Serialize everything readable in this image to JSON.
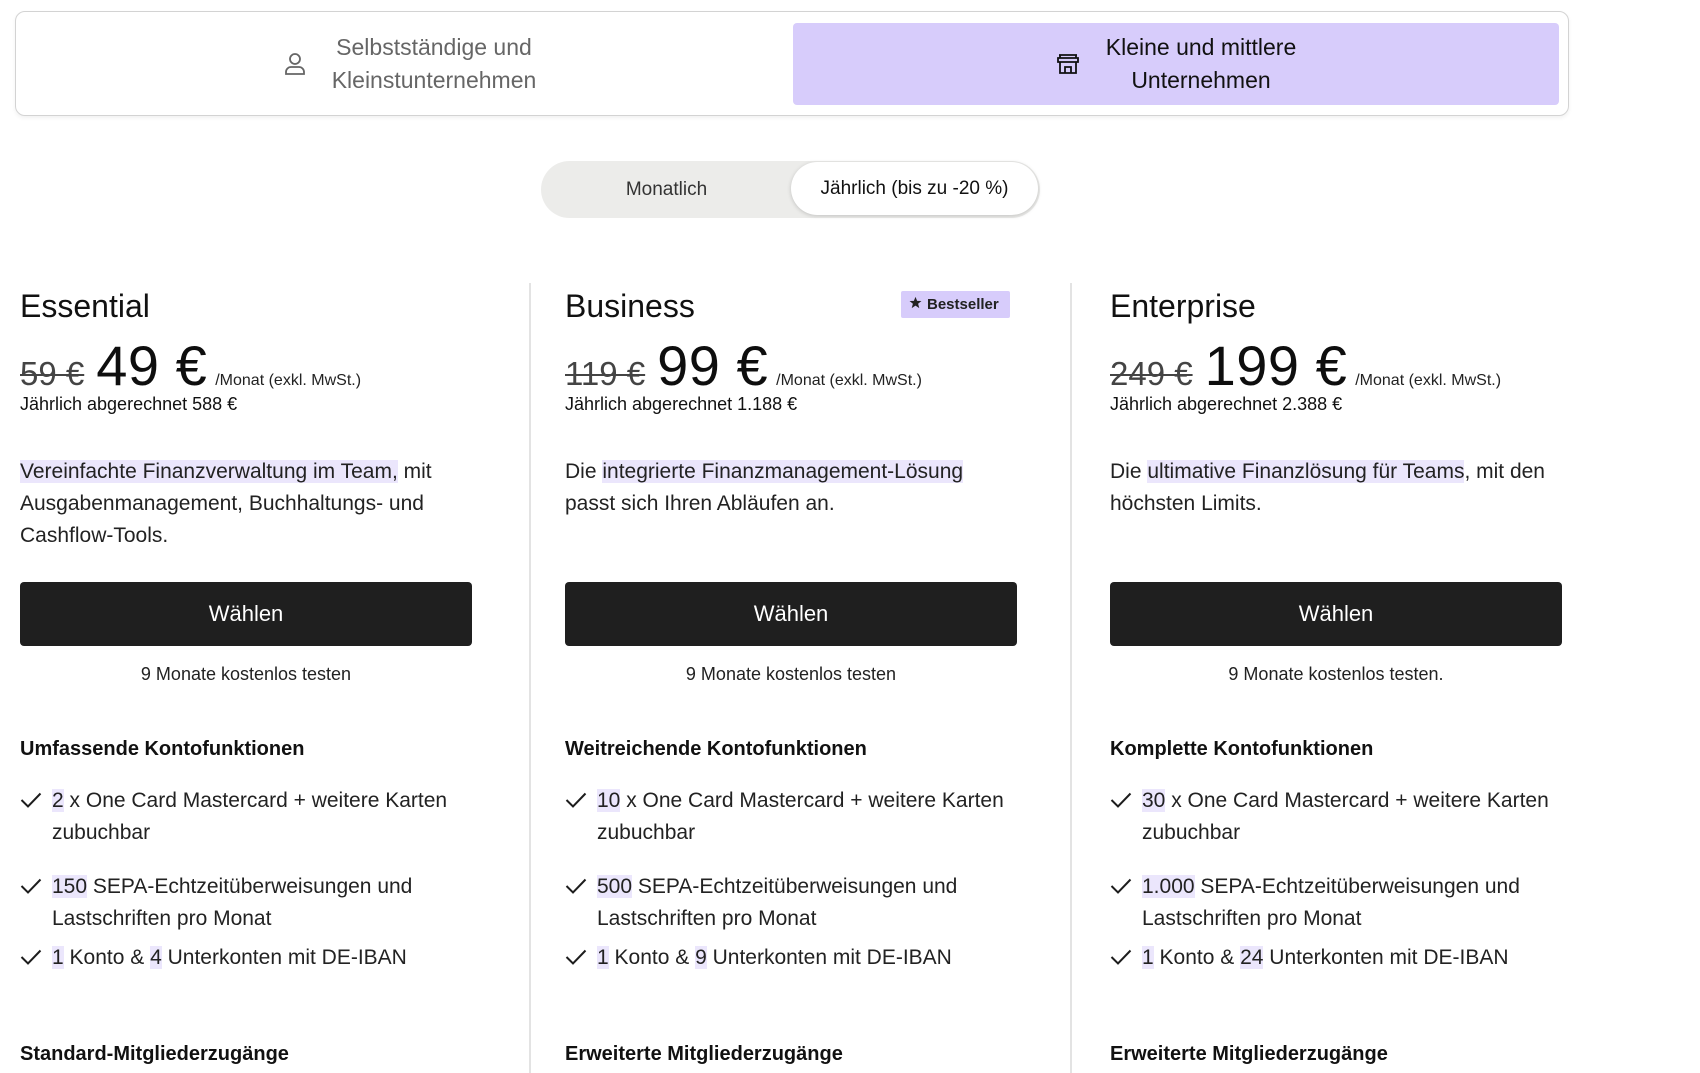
{
  "segments": {
    "left_label": "Selbstständige und\nKleinstunternehmen",
    "right_label": "Kleine und mittlere\nUnternehmen"
  },
  "billing": {
    "monthly": "Monatlich",
    "yearly": "Jährlich (bis zu -20 %)"
  },
  "plans": [
    {
      "name": "Essential",
      "old_price": "59 €",
      "price": "49 €",
      "per": "/Monat (exkl. MwSt.)",
      "billed": "Jährlich abgerechnet 588 €",
      "desc_pre": "",
      "desc_hl": "Vereinfachte Finanzverwaltung im Team,",
      "desc_post": " mit Ausgabenmanagement, Buchhaltungs- und Cashflow-Tools.",
      "cta": "Wählen",
      "trial": "9 Monate kostenlos testen",
      "section1": "Umfassende Kontofunktionen",
      "cards_n": "2",
      "cards_text": " x One Card Mastercard + weitere Karten zubuchbar",
      "sepa_n": "150",
      "sepa_text": " SEPA-Echtzeitüberweisungen und Lastschriften pro Monat",
      "acc_n": "1",
      "acc_mid": " Konto & ",
      "sub_n": "4",
      "acc_text": " Unterkonten mit DE-IBAN",
      "section2": "Standard-Mitgliederzugänge"
    },
    {
      "name": "Business",
      "badge": "Bestseller",
      "old_price": "119 €",
      "price": "99 €",
      "per": "/Monat (exkl. MwSt.)",
      "billed": "Jährlich abgerechnet 1.188 €",
      "desc_pre": "Die ",
      "desc_hl": "integrierte Finanzmanagement-Lösung",
      "desc_post": " passt sich Ihren Abläufen an.",
      "cta": "Wählen",
      "trial": "9 Monate kostenlos testen",
      "section1": "Weitreichende Kontofunktionen",
      "cards_n": "10",
      "cards_text": " x One Card Mastercard + weitere Karten zubuchbar",
      "sepa_n": "500",
      "sepa_text": " SEPA-Echtzeitüberweisungen und Lastschriften pro Monat",
      "acc_n": "1",
      "acc_mid": " Konto & ",
      "sub_n": "9",
      "acc_text": " Unterkonten mit DE-IBAN",
      "section2": "Erweiterte Mitgliederzugänge"
    },
    {
      "name": "Enterprise",
      "old_price": "249 €",
      "price": "199 €",
      "per": "/Monat (exkl. MwSt.)",
      "billed": "Jährlich abgerechnet 2.388 €",
      "desc_pre": "Die ",
      "desc_hl": "ultimative Finanzlösung für Teams",
      "desc_post": ", mit den höchsten Limits.",
      "cta": "Wählen",
      "trial": "9 Monate kostenlos testen.",
      "section1": "Komplette Kontofunktionen",
      "cards_n": "30",
      "cards_text": " x One Card Mastercard + weitere Karten zubuchbar",
      "sepa_n": "1.000",
      "sepa_text": " SEPA-Echtzeitüberweisungen und Lastschriften pro Monat",
      "acc_n": "1",
      "acc_mid": " Konto & ",
      "sub_n": "24",
      "acc_text": " Unterkonten mit DE-IBAN",
      "section2": "Erweiterte Mitgliederzugänge"
    }
  ],
  "colors": {
    "accent": "#d7ccfb",
    "highlight": "#ebe6fc",
    "cta_bg": "#1f1f1f"
  },
  "icons": {
    "left_segment": "person-icon",
    "right_segment": "store-icon",
    "badge": "star-icon",
    "feature": "check-icon"
  }
}
